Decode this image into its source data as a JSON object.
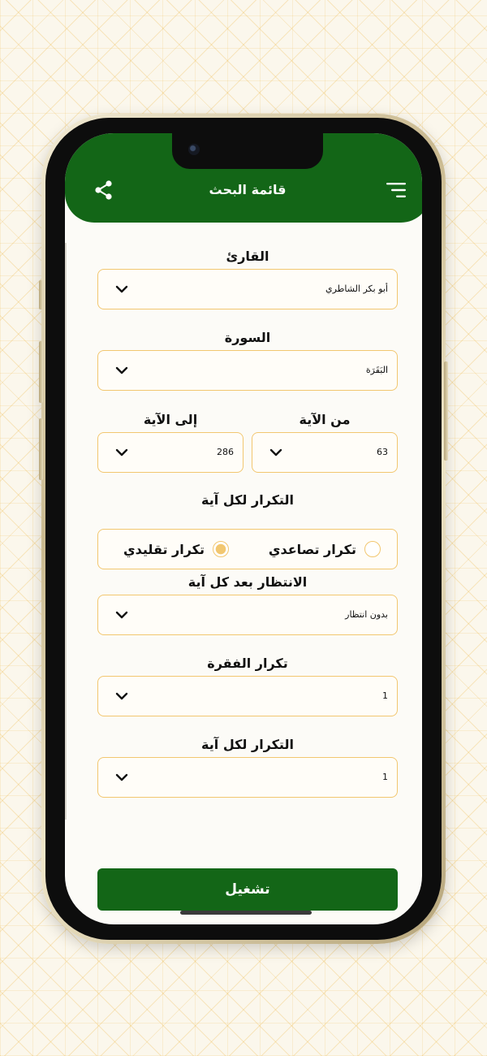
{
  "header": {
    "title": "قائمة البحث",
    "share_icon": "share-icon",
    "menu_icon": "menu-icon"
  },
  "form": {
    "reciter": {
      "label": "القارئ",
      "value": "أبو بكر الشاطري"
    },
    "surah": {
      "label": "السورة",
      "value": "البَقَرَة"
    },
    "from_ayah": {
      "label": "من الآية",
      "value": "63"
    },
    "to_ayah": {
      "label": "إلى الآية",
      "value": "286"
    },
    "repeat_mode": {
      "label": "التكرار لكل آية",
      "options": [
        "تكرار تصاعدي",
        "تكرار تقليدي"
      ],
      "selected": "تكرار تقليدي"
    },
    "wait": {
      "label": "الانتظار بعد كل آية",
      "value": "بدون انتظار"
    },
    "passage_repeat": {
      "label": "تكرار الفقرة",
      "value": "1"
    },
    "ayah_repeat": {
      "label": "التكرار لكل آية",
      "value": "1"
    },
    "play_label": "تشغيل"
  },
  "colors": {
    "primary_green": "#136617",
    "accent_gold": "#f2c770"
  }
}
